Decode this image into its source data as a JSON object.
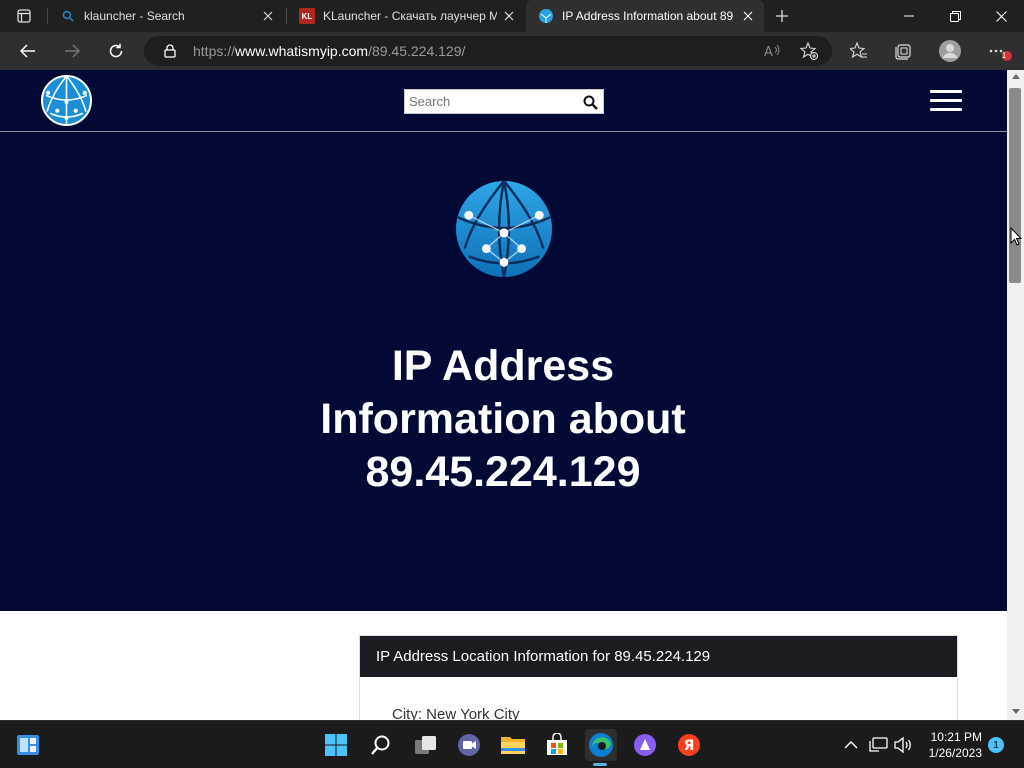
{
  "browser": {
    "tabs": [
      {
        "title": "klauncher - Search",
        "active": false
      },
      {
        "title": "KLauncher - Скачать лаунчер M",
        "favicon_text": "KL",
        "active": false
      },
      {
        "title": "IP Address Information about 89",
        "active": true
      }
    ],
    "address": {
      "scheme": "https://",
      "host": "www.whatismyip.com",
      "path": "/89.45.224.129/"
    },
    "notification_count": "1"
  },
  "site": {
    "search_placeholder": "Search",
    "hero_title": "IP Address Information about 89.45.224.129",
    "card_title": "IP Address Location Information for 89.45.224.129",
    "city_line": "City: New York City",
    "colors": {
      "header_bg": "#010934",
      "card_header_bg": "#1b1c21",
      "logo_blue": "#1a8fd8"
    }
  },
  "taskbar": {
    "time": "10:21 PM",
    "date": "1/26/2023",
    "notification_badge": "1",
    "apps": [
      "start-icon",
      "search-icon",
      "task-view-icon",
      "teams-chat-icon",
      "file-explorer-icon",
      "microsoft-store-icon",
      "edge-icon",
      "alice-icon",
      "yandex-browser-icon"
    ]
  }
}
